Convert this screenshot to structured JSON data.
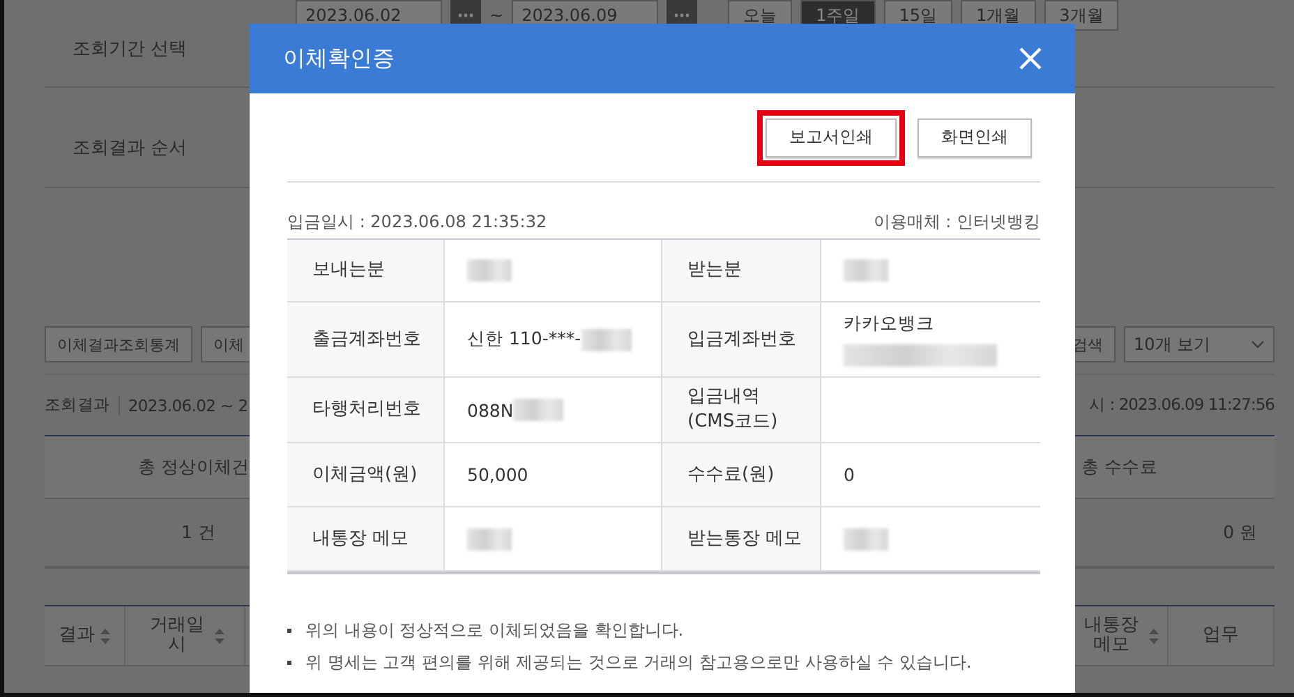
{
  "search_form": {
    "rows": [
      {
        "label": "조회기간 선택"
      },
      {
        "label": "조회결과 순서"
      }
    ],
    "start_date": "2023.06.02",
    "separator": "~",
    "end_date": "2023.06.09",
    "periods": [
      {
        "label": "오늘",
        "selected": false
      },
      {
        "label": "1주일",
        "selected": true
      },
      {
        "label": "15일",
        "selected": false
      },
      {
        "label": "1개월",
        "selected": false
      },
      {
        "label": "3개월",
        "selected": false
      }
    ]
  },
  "toolbar": {
    "buttons": [
      "이체결과조회통계",
      "이체"
    ],
    "search_button": "검색",
    "page_size": "10개 보기"
  },
  "result_bar": {
    "label": "조회결과",
    "period": "2023.06.02 ~ 2",
    "timestamp": "시 : 2023.06.09 11:27:56"
  },
  "summary": {
    "headers": [
      "총 정상이체건",
      "총 수수료"
    ],
    "values": [
      "1 건",
      "0 원"
    ]
  },
  "list_columns": [
    {
      "label": "결과",
      "sortable": true
    },
    {
      "label": "거래일시",
      "sortable": true
    },
    {
      "label": "내통장 메모",
      "sortable": true
    },
    {
      "label": "업무",
      "sortable": false
    }
  ],
  "dialog": {
    "title": "이체확인증",
    "buttons": [
      {
        "label": "보고서인쇄",
        "highlighted": true
      },
      {
        "label": "화면인쇄",
        "highlighted": false
      }
    ],
    "deposit_time": "입금일시 : 2023.06.08 21:35:32",
    "channel": "이용매체 : 인터넷뱅킹",
    "rows": [
      {
        "cells": [
          {
            "label": "보내는분",
            "value": {
              "redacted": true
            }
          },
          {
            "label": "받는분",
            "value": {
              "redacted": true
            }
          }
        ]
      },
      {
        "cells": [
          {
            "label": "출금계좌번호",
            "value": {
              "text": "신한 110-***-",
              "redacted": true
            }
          },
          {
            "label": "입금계좌번호",
            "value": {
              "text": "카카오뱅크",
              "redacted": true
            }
          }
        ]
      },
      {
        "cells": [
          {
            "label": "타행처리번호",
            "value": {
              "text": "088N",
              "redacted": true
            }
          },
          {
            "label": "입금내역\n(CMS코드)",
            "value": {
              "redacted": false
            }
          }
        ]
      },
      {
        "cells": [
          {
            "label": "이체금액(원)",
            "value": {
              "text": "50,000",
              "redacted": false
            }
          },
          {
            "label": "수수료(원)",
            "value": {
              "text": "0",
              "redacted": false
            }
          }
        ]
      },
      {
        "cells": [
          {
            "label": "내통장 메모",
            "value": {
              "redacted": true
            }
          },
          {
            "label": "받는통장 메모",
            "value": {
              "redacted": true
            }
          }
        ]
      }
    ],
    "notes": [
      "위의 내용이 정상적으로 이체되었음을 확인합니다.",
      "위 명세는 고객 편의를 위해 제공되는 것으로 거래의 참고용으로만 사용하실 수 있습니다."
    ]
  }
}
